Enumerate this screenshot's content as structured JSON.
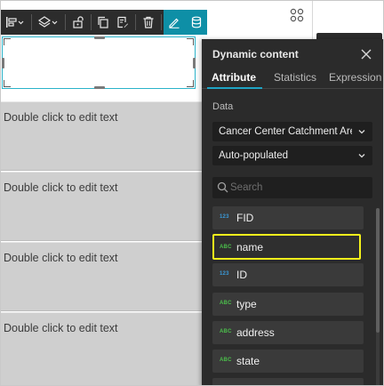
{
  "canvas": {
    "placeholder_texts": [
      "Double click to edit text",
      "Double click to edit text",
      "Double click to edit text",
      "Double click to edit text"
    ]
  },
  "toolbar": {
    "buttons": [
      {
        "name": "align-icon",
        "icon": "align-left-icon"
      },
      {
        "name": "layers-icon",
        "icon": "layers-icon"
      },
      {
        "name": "unlock-icon",
        "icon": "unlock-icon"
      },
      {
        "name": "copy-icon",
        "icon": "copy-icon"
      },
      {
        "name": "save-template-icon",
        "icon": "save-template-icon"
      },
      {
        "name": "delete-icon",
        "icon": "trash-icon"
      },
      {
        "name": "edit-icon",
        "icon": "pencil-icon"
      },
      {
        "name": "dynamic-content-icon",
        "icon": "database-icon"
      }
    ],
    "accent_color": "#0e8fa6"
  },
  "panel": {
    "title": "Dynamic content",
    "tabs": [
      {
        "label": "Attribute",
        "active": true
      },
      {
        "label": "Statistics",
        "active": false
      },
      {
        "label": "Expression",
        "active": false
      }
    ],
    "data_label": "Data",
    "data_source_value": "Cancer Center Catchment Are...",
    "mode_value": "Auto-populated",
    "search_placeholder": "Search",
    "fields": [
      {
        "type": "123",
        "name": "FID",
        "highlighted": false
      },
      {
        "type": "ABC",
        "name": "name",
        "highlighted": true
      },
      {
        "type": "123",
        "name": "ID",
        "highlighted": false
      },
      {
        "type": "ABC",
        "name": "type",
        "highlighted": false
      },
      {
        "type": "ABC",
        "name": "address",
        "highlighted": false
      },
      {
        "type": "ABC",
        "name": "state",
        "highlighted": false
      }
    ],
    "colors": {
      "number_type": "#3a9ad9",
      "string_type": "#4bbf4b",
      "highlight": "#f5f21b",
      "tab_underline": "#1fa4c4"
    }
  }
}
